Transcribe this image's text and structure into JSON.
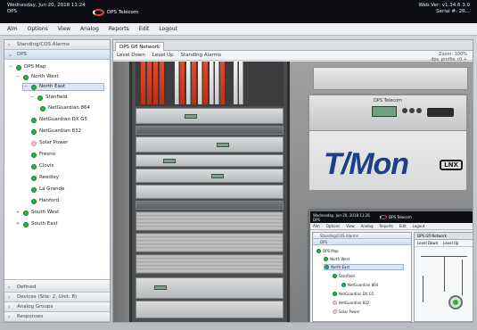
{
  "window": {
    "title_lines": [
      "Wednesday, Jun 20, 2018 11:24",
      "DPS"
    ],
    "brand": "DPS Telecom",
    "right_lines": [
      "Web Ver: v1.34.6 3.0",
      "Serial #: 2R..."
    ]
  },
  "menu": [
    "Alm",
    "Options",
    "View",
    "Analog",
    "Reports",
    "Edit",
    "Logout"
  ],
  "left_panel": {
    "heads_top": [
      "Standing/COS Alarms",
      "DPS"
    ],
    "tree": [
      {
        "label": "DPS Map",
        "level": 1,
        "status": "green",
        "expander": "−"
      },
      {
        "label": "North West",
        "level": 2,
        "status": "green",
        "expander": "−"
      },
      {
        "label": "North East",
        "level": 3,
        "status": "green",
        "expander": "−",
        "selected": true
      },
      {
        "label": "Stanfield",
        "level": 4,
        "status": "green",
        "expander": "−"
      },
      {
        "label": "NetGuardian 864",
        "level": 5,
        "status": "green",
        "expander": ""
      },
      {
        "label": "NetGuardian DX G5",
        "level": 4,
        "status": "green",
        "expander": ""
      },
      {
        "label": "NetGuardian 832",
        "level": 4,
        "status": "green",
        "expander": ""
      },
      {
        "label": "Solar Power",
        "level": 4,
        "status": "pink",
        "expander": ""
      },
      {
        "label": "Fresno",
        "level": 4,
        "status": "green",
        "expander": ""
      },
      {
        "label": "Clovis",
        "level": 4,
        "status": "green",
        "expander": ""
      },
      {
        "label": "Reedley",
        "level": 4,
        "status": "green",
        "expander": ""
      },
      {
        "label": "La Grande",
        "level": 4,
        "status": "green",
        "expander": ""
      },
      {
        "label": "Hanford",
        "level": 4,
        "status": "green",
        "expander": ""
      },
      {
        "label": "South West",
        "level": 2,
        "status": "green",
        "expander": "+"
      },
      {
        "label": "South East",
        "level": 2,
        "status": "green",
        "expander": "+"
      }
    ],
    "heads_bottom": [
      "Defined",
      "Devices (Site: 2, Unit: 8)",
      "Analog Groups",
      "Responses"
    ]
  },
  "main": {
    "tab_label": "DPS Gfl Network",
    "subtabs": [
      "Level Down",
      "Level Up",
      "Standing Alarms"
    ],
    "panel_info": [
      "Zoom: 100%",
      "dps_profile_r0 +"
    ]
  },
  "photo": {
    "device_name": "T/Mon",
    "device_sub": "LNX",
    "device_brand": "DPS Telecom"
  },
  "inset": {
    "title_lines": [
      "Wednesday, Jun 20, 2018 11:26",
      "DPS"
    ],
    "brand": "DPS Telecom",
    "menu": [
      "Alm",
      "Options",
      "View",
      "Analog",
      "Reports",
      "Edit",
      "Logout"
    ],
    "heads": [
      "Standing/COS Alarms",
      "DPS"
    ],
    "tree": [
      {
        "label": "DPS Map",
        "status": "green",
        "level": 1
      },
      {
        "label": "North West",
        "status": "green",
        "level": 2
      },
      {
        "label": "North East",
        "status": "green",
        "level": 2,
        "selected": true
      },
      {
        "label": "Stanfield",
        "status": "green",
        "level": 3
      },
      {
        "label": "NetGuardian 864",
        "status": "green",
        "level": 4
      },
      {
        "label": "NetGuardian DX G5",
        "status": "green",
        "level": 3
      },
      {
        "label": "NetGuardian 832",
        "status": "pink",
        "level": 3
      },
      {
        "label": "Solar Power",
        "status": "pink",
        "level": 3
      }
    ],
    "tab_label": "DPS Gfl Network",
    "subtabs": [
      "Level Down",
      "Level Up"
    ]
  },
  "colors": {
    "status_ok": "#29b34a",
    "status_warn": "#f2c6ce",
    "titlebar": "#0d0f14",
    "selection": "#dbe6f5"
  }
}
